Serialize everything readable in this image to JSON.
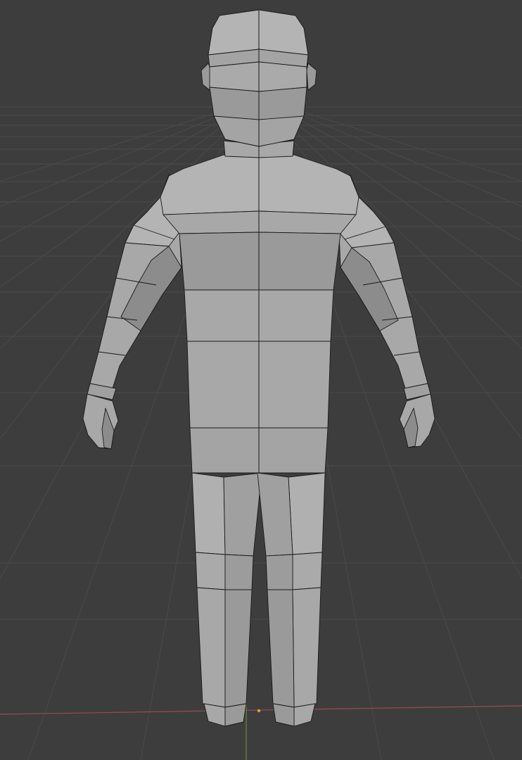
{
  "viewport": {
    "background_color": "#3d3d3d",
    "grid_color": "#4a4a4a",
    "grid_color_major": "#525252",
    "x_axis_color": "#9a4a55",
    "y_axis_color": "#6a8a3a",
    "origin_color": "#e0a020"
  },
  "model": {
    "fill_main": "#a8a8a8",
    "fill_light": "#b4b4b4",
    "fill_dark": "#8c8c8c",
    "fill_shadow": "#7e7e7e",
    "edge_color": "#1a1a1a"
  }
}
